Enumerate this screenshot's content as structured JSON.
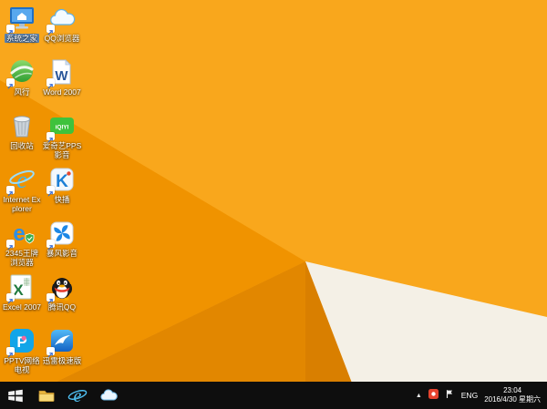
{
  "wallpaper": {
    "base": "#F9A71C",
    "facet_mid": "#F09300",
    "facet_dark": "#E28700",
    "facet_sliver": "#D97F00",
    "facet_white": "#F4F0E6"
  },
  "desktop": {
    "icons": [
      {
        "name": "system-home",
        "label": "系统之家",
        "selected": true
      },
      {
        "name": "funshion",
        "label": "风行"
      },
      {
        "name": "recycle-bin",
        "label": "回收站"
      },
      {
        "name": "internet-explorer",
        "label": "Internet Explorer",
        "glyph": "e"
      },
      {
        "name": "browser-2345",
        "label": "2345王牌浏览器",
        "glyph": "e"
      },
      {
        "name": "excel-2007",
        "label": "Excel 2007",
        "glyph": "X"
      },
      {
        "name": "pptv",
        "label": "PPTV网络电视",
        "glyph": "P"
      },
      {
        "name": "qq-browser",
        "label": "QQ浏览器"
      },
      {
        "name": "word-2007",
        "label": "Word 2007",
        "glyph": "W"
      },
      {
        "name": "iqiyi-pps",
        "label": "爱奇艺PPS影音",
        "glyph": "iQIYI"
      },
      {
        "name": "kuaibo",
        "label": "快播",
        "glyph": "K"
      },
      {
        "name": "baofeng",
        "label": "暴风影音"
      },
      {
        "name": "tencent-qq",
        "label": "腾讯QQ"
      },
      {
        "name": "xunlei",
        "label": "迅雷极速版"
      }
    ]
  },
  "taskbar": {
    "background": "#0E0E0E",
    "pinned": [
      {
        "name": "file-explorer"
      },
      {
        "name": "internet-explorer",
        "glyph": "e"
      },
      {
        "name": "qq-browser"
      }
    ],
    "tray": {
      "hidden_icons_glyph": "▲",
      "language": "ENG",
      "time": "23:04",
      "date": "2016/4/30 星期六"
    }
  }
}
